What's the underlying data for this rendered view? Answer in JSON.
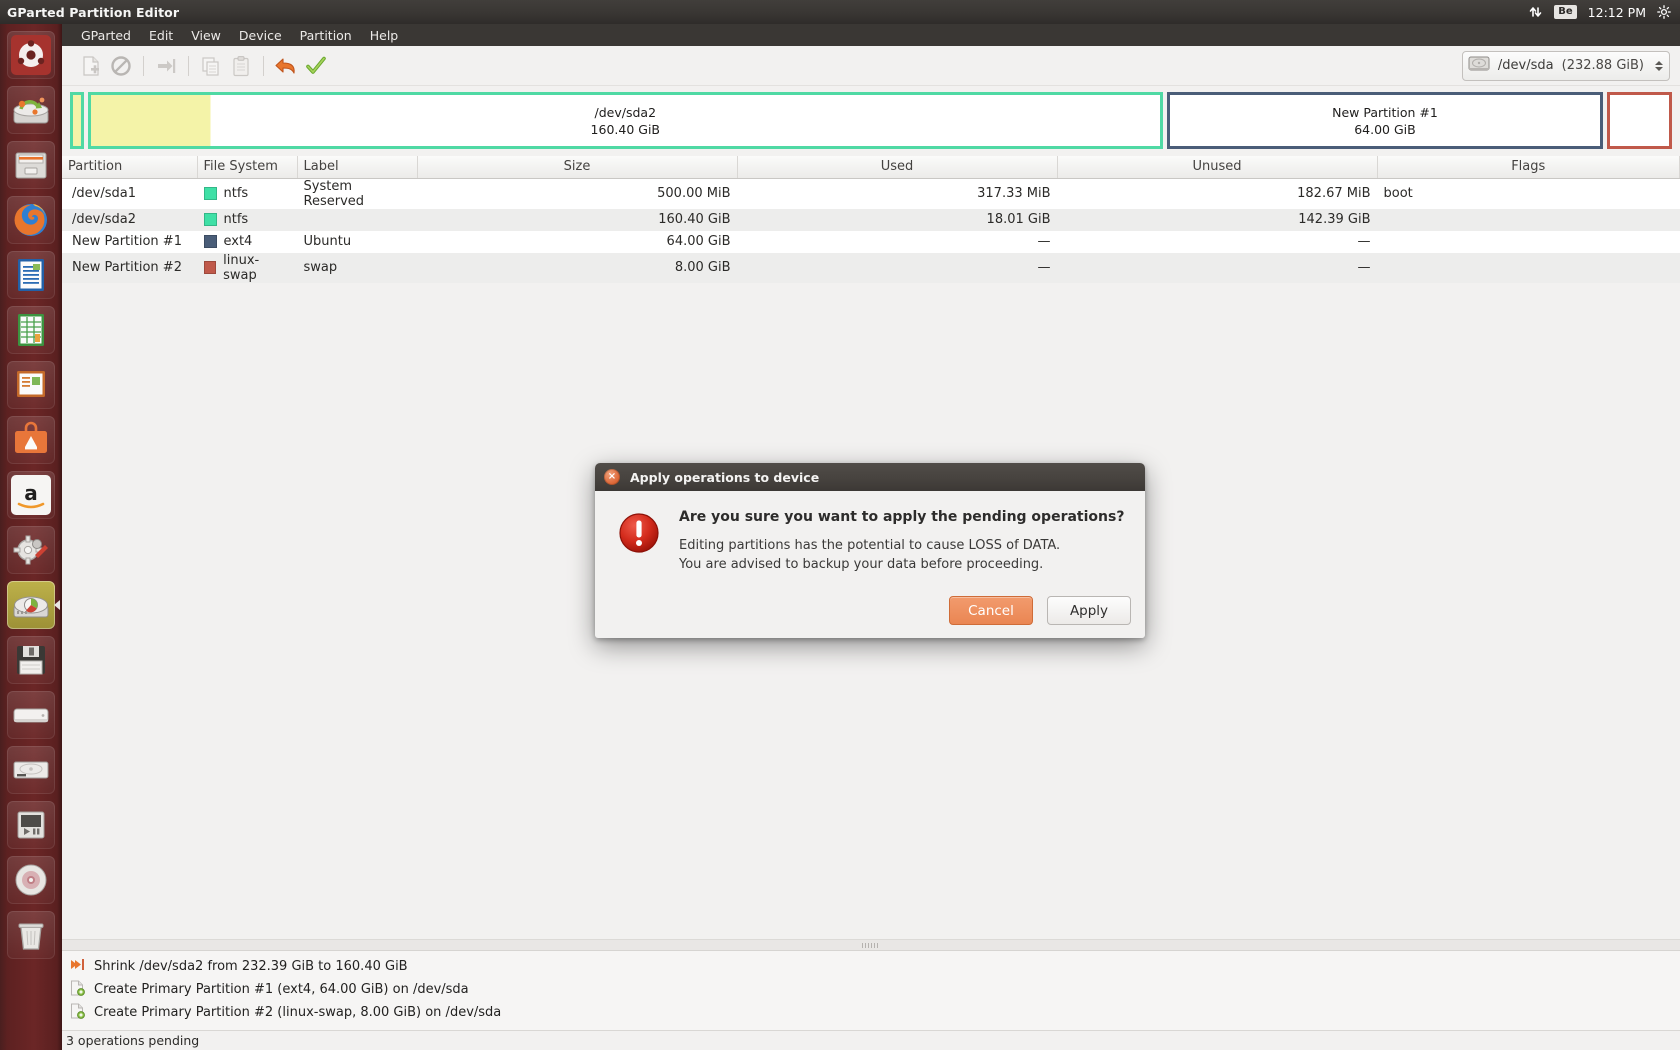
{
  "top_panel": {
    "title": "GParted Partition Editor",
    "indicators": [
      {
        "name": "network-indicator-icon",
        "glyph": "updown-arrows"
      },
      {
        "name": "keyboard-layout-indicator",
        "label": "Be"
      }
    ],
    "clock": "12:12 PM",
    "session_icon": "gear-icon"
  },
  "launcher": {
    "items": [
      {
        "name": "ubuntu-dash-icon",
        "label": "Ubuntu Dash",
        "active": false
      },
      {
        "name": "gparted-live-installer-icon",
        "label": "Install Ubuntu",
        "active": false
      },
      {
        "name": "files-nautilus-icon",
        "label": "Files",
        "active": false
      },
      {
        "name": "firefox-icon",
        "label": "Firefox Web Browser",
        "active": false
      },
      {
        "name": "libreoffice-writer-icon",
        "label": "LibreOffice Writer",
        "active": false
      },
      {
        "name": "libreoffice-calc-icon",
        "label": "LibreOffice Calc",
        "active": false
      },
      {
        "name": "libreoffice-impress-icon",
        "label": "LibreOffice Impress",
        "active": false
      },
      {
        "name": "ubuntu-software-center-icon",
        "label": "Ubuntu Software Center",
        "active": false
      },
      {
        "name": "amazon-icon",
        "label": "Amazon",
        "active": false
      },
      {
        "name": "system-settings-icon",
        "label": "System Settings",
        "active": false
      },
      {
        "name": "gparted-icon",
        "label": "GParted",
        "active": true
      },
      {
        "name": "floppy-drive-icon",
        "label": "Floppy Drive",
        "active": false
      },
      {
        "name": "external-drive-icon",
        "label": "External Drive",
        "active": false
      },
      {
        "name": "hard-disk-icon",
        "label": "Hard Disk",
        "active": false
      },
      {
        "name": "media-player-icon",
        "label": "Media Player",
        "active": false
      },
      {
        "name": "cd-drive-icon",
        "label": "CD/DVD Drive",
        "active": false
      },
      {
        "name": "trash-icon",
        "label": "Trash",
        "active": false
      }
    ]
  },
  "menubar": {
    "items": [
      {
        "name": "menu-gparted",
        "label": "GParted"
      },
      {
        "name": "menu-edit",
        "label": "Edit"
      },
      {
        "name": "menu-view",
        "label": "View"
      },
      {
        "name": "menu-device",
        "label": "Device"
      },
      {
        "name": "menu-partition",
        "label": "Partition"
      },
      {
        "name": "menu-help",
        "label": "Help"
      }
    ]
  },
  "toolbar": {
    "buttons": [
      {
        "name": "new-partition-button",
        "icon": "new-document-icon",
        "enabled": false
      },
      {
        "name": "delete-partition-button",
        "icon": "delete-prohibited-icon",
        "enabled": false
      },
      {
        "name": "resize-move-button",
        "icon": "resize-move-icon",
        "enabled": false
      },
      {
        "name": "copy-button",
        "icon": "copy-icon",
        "enabled": false
      },
      {
        "name": "paste-button",
        "icon": "paste-icon",
        "enabled": false
      },
      {
        "name": "undo-button",
        "icon": "undo-arrow-icon",
        "enabled": true
      },
      {
        "name": "apply-button",
        "icon": "green-check-icon",
        "enabled": true
      }
    ],
    "device_selector": {
      "icon": "hard-disk-icon",
      "device": "/dev/sda",
      "size": "(232.88 GiB)"
    }
  },
  "graphic_bar": {
    "segments": [
      {
        "name": "sda1-graphic",
        "label": "",
        "sublabel": "",
        "border": "#4fd9a4",
        "fill": "#ffffff",
        "used_fill": "#f4f3a8",
        "flex": 0.9,
        "used_pct": 100,
        "show_label": false
      },
      {
        "name": "sda2-graphic",
        "label": "/dev/sda2",
        "sublabel": "160.40 GiB",
        "border": "#4fd9a4",
        "fill": "#ffffff",
        "used_fill": "#f4f3a8",
        "flex": 62,
        "used_pct": 11.2,
        "show_label": true
      },
      {
        "name": "new-partition-1-graphic",
        "label": "New Partition #1",
        "sublabel": "64.00 GiB",
        "border": "#4a5d78",
        "fill": "#ffffff",
        "used_fill": "#ffffff",
        "flex": 25,
        "used_pct": 0,
        "show_label": true
      },
      {
        "name": "new-partition-2-graphic",
        "label": "",
        "sublabel": "",
        "border": "#c0594a",
        "fill": "#ffffff",
        "used_fill": "#ffffff",
        "flex": 3.4,
        "used_pct": 0,
        "show_label": false
      }
    ]
  },
  "table": {
    "columns": [
      {
        "name": "col-partition",
        "label": "Partition"
      },
      {
        "name": "col-filesystem",
        "label": "File System"
      },
      {
        "name": "col-label",
        "label": "Label"
      },
      {
        "name": "col-size",
        "label": "Size"
      },
      {
        "name": "col-used",
        "label": "Used"
      },
      {
        "name": "col-unused",
        "label": "Unused"
      },
      {
        "name": "col-flags",
        "label": "Flags"
      }
    ],
    "rows": [
      {
        "partition": "/dev/sda1",
        "fs": "ntfs",
        "fs_color": "#3fe0a6",
        "label": "System Reserved",
        "size": "500.00 MiB",
        "used": "317.33 MiB",
        "unused": "182.67 MiB",
        "flags": "boot"
      },
      {
        "partition": "/dev/sda2",
        "fs": "ntfs",
        "fs_color": "#3fe0a6",
        "label": "",
        "size": "160.40 GiB",
        "used": "18.01 GiB",
        "unused": "142.39 GiB",
        "flags": ""
      },
      {
        "partition": "New Partition #1",
        "fs": "ext4",
        "fs_color": "#4a5d78",
        "label": "Ubuntu",
        "size": "64.00 GiB",
        "used": "—",
        "unused": "—",
        "flags": ""
      },
      {
        "partition": "New Partition #2",
        "fs": "linux-swap",
        "fs_color": "#c0594a",
        "label": "swap",
        "size": "8.00 GiB",
        "used": "—",
        "unused": "—",
        "flags": ""
      }
    ]
  },
  "operations": {
    "items": [
      {
        "name": "operation-shrink",
        "icon": "shrink-arrow-icon",
        "text": "Shrink /dev/sda2 from 232.39 GiB to 160.40 GiB"
      },
      {
        "name": "operation-create-1",
        "icon": "create-partition-icon",
        "text": "Create Primary Partition #1 (ext4, 64.00 GiB) on /dev/sda"
      },
      {
        "name": "operation-create-2",
        "icon": "create-partition-icon",
        "text": "Create Primary Partition #2 (linux-swap, 8.00 GiB) on /dev/sda"
      }
    ],
    "status": "3 operations pending"
  },
  "dialog": {
    "title": "Apply operations to device",
    "close_icon": "close-icon",
    "warning_icon": "warning-exclamation-icon",
    "heading": "Are you sure you want to apply the pending operations?",
    "body_line1": "Editing partitions has the potential to cause LOSS of DATA.",
    "body_line2": "You are advised to backup your data before proceeding.",
    "cancel_label": "Cancel",
    "apply_label": "Apply"
  },
  "colors": {
    "ntfs": "#3fe0a6",
    "ext4": "#4a5d78",
    "linux_swap": "#c0594a",
    "used_yellow": "#f4f3a8",
    "accent_orange": "#ea8653",
    "panel_dark": "#3a3734",
    "launcher_red": "#6b2626"
  }
}
